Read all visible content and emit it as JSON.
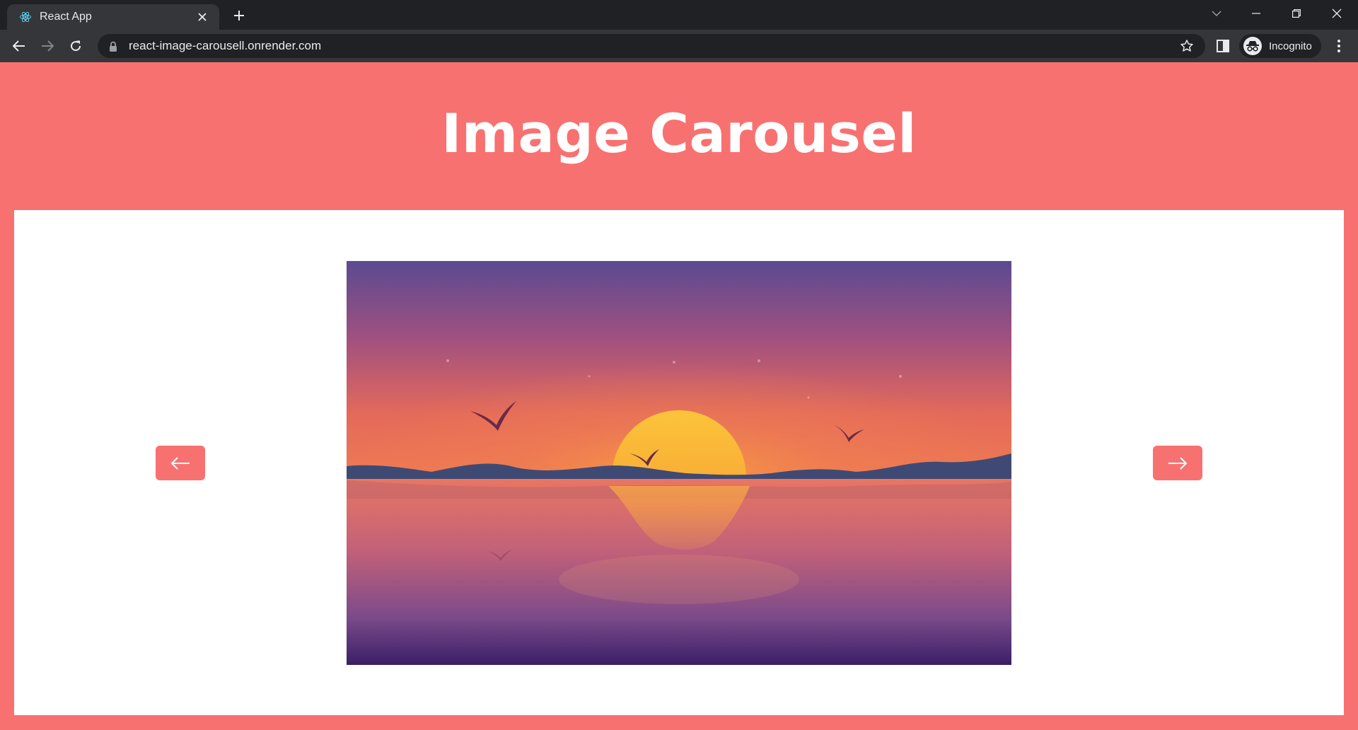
{
  "browser": {
    "tab_title": "React App",
    "url": "react-image-carousell.onrender.com",
    "profile_label": "Incognito"
  },
  "page": {
    "title": "Image Carousel"
  },
  "carousel": {
    "prev_label": "←",
    "next_label": "→",
    "current_image": "sunset-over-lake"
  },
  "colors": {
    "accent": "#f87171",
    "card": "#ffffff",
    "chrome_dark": "#202124",
    "chrome_toolbar": "#35363a"
  }
}
